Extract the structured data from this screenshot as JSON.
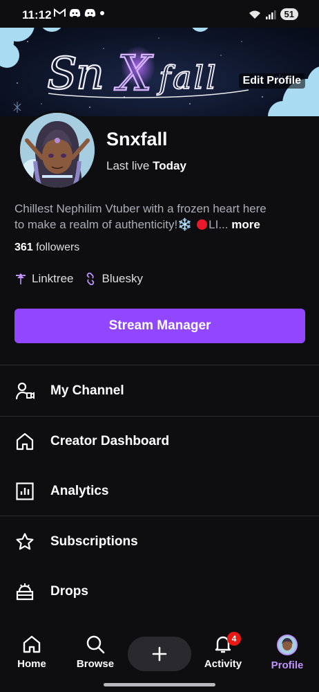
{
  "status_bar": {
    "time": "11:12",
    "battery": "51"
  },
  "banner": {
    "logo_text": "SnXfall",
    "edit_profile_label": "Edit Profile"
  },
  "profile": {
    "name": "Snxfall",
    "last_live_prefix": "Last live",
    "last_live_value": "Today",
    "bio_line1": "Chillest Nephilim Vtuber with a frozen heart here",
    "bio_line2": "to make a realm of authenticity!",
    "bio_emoji": "❄️",
    "bio_tail": "LI...",
    "more_label": "more",
    "followers_count": "361",
    "followers_label": "followers"
  },
  "links": [
    {
      "label": "Linktree",
      "icon": "linktree-icon"
    },
    {
      "label": "Bluesky",
      "icon": "bluesky-icon"
    }
  ],
  "stream_manager_label": "Stream Manager",
  "menu": [
    {
      "label": "My Channel",
      "icon": "channel-icon"
    },
    {
      "label": "Creator Dashboard",
      "icon": "home-dashboard-icon"
    },
    {
      "label": "Analytics",
      "icon": "analytics-icon"
    },
    {
      "label": "Subscriptions",
      "icon": "star-icon"
    },
    {
      "label": "Drops",
      "icon": "drops-icon"
    }
  ],
  "bottom_nav": [
    {
      "label": "Home",
      "icon": "home-icon"
    },
    {
      "label": "Browse",
      "icon": "search-icon"
    },
    {
      "label": "Activity",
      "icon": "bell-icon",
      "badge": "4"
    },
    {
      "label": "Profile",
      "icon": "profile-avatar-icon",
      "active": true
    }
  ],
  "colors": {
    "accent": "#9147ff",
    "accent_light": "#bf94ff",
    "background": "#0e0e10",
    "badge": "#e91916"
  }
}
